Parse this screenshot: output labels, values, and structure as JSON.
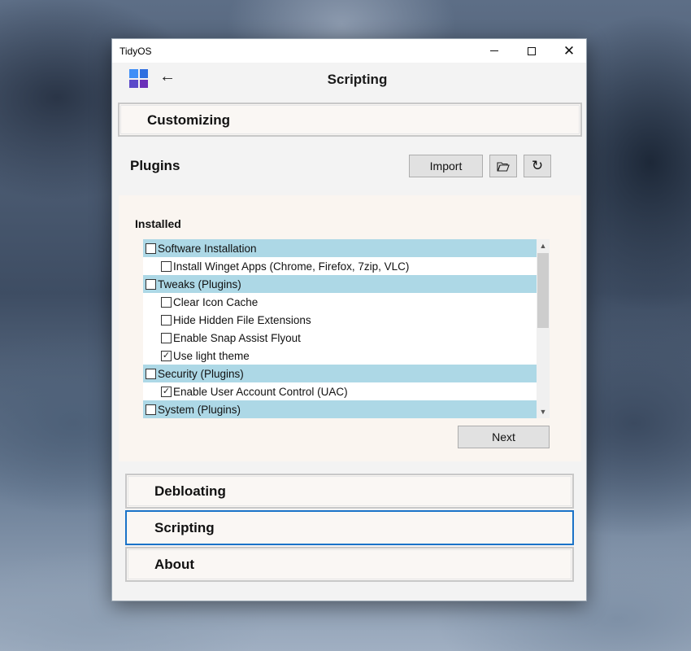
{
  "window": {
    "title": "TidyOS",
    "page_title": "Scripting",
    "controls": {
      "minimize": "minimize-icon",
      "maximize": "maximize-icon",
      "close": "close-icon"
    }
  },
  "header": {
    "logo_icon": "windows-logo-icon",
    "back_icon": "back-arrow-icon",
    "back_glyph": "←",
    "logo_colors": [
      "#3f8ef7",
      "#2f6fe0",
      "#5a49c9",
      "#6a2fb8"
    ]
  },
  "sections": {
    "customizing": "Customizing",
    "debloating": "Debloating",
    "scripting": "Scripting",
    "about": "About"
  },
  "plugins": {
    "title": "Plugins",
    "import_label": "Import",
    "folder_icon": "folder-open-icon",
    "refresh_icon": "refresh-icon",
    "refresh_glyph": "↻",
    "installed_title": "Installed",
    "next_label": "Next",
    "items": [
      {
        "label": "Software Installation",
        "group": true,
        "checked": false
      },
      {
        "label": "Install Winget Apps (Chrome, Firefox, 7zip, VLC)",
        "group": false,
        "checked": false
      },
      {
        "label": "Tweaks (Plugins)",
        "group": true,
        "checked": false
      },
      {
        "label": "Clear Icon Cache",
        "group": false,
        "checked": false
      },
      {
        "label": "Hide Hidden File Extensions",
        "group": false,
        "checked": false
      },
      {
        "label": "Enable Snap Assist Flyout",
        "group": false,
        "checked": false
      },
      {
        "label": "Use light theme",
        "group": false,
        "checked": true
      },
      {
        "label": "Security (Plugins)",
        "group": true,
        "checked": false
      },
      {
        "label": "Enable User Account Control (UAC)",
        "group": false,
        "checked": true
      },
      {
        "label": "System (Plugins)",
        "group": true,
        "checked": false
      }
    ]
  },
  "colors": {
    "group_row": "#add8e6",
    "active_border": "#1a73c8"
  }
}
